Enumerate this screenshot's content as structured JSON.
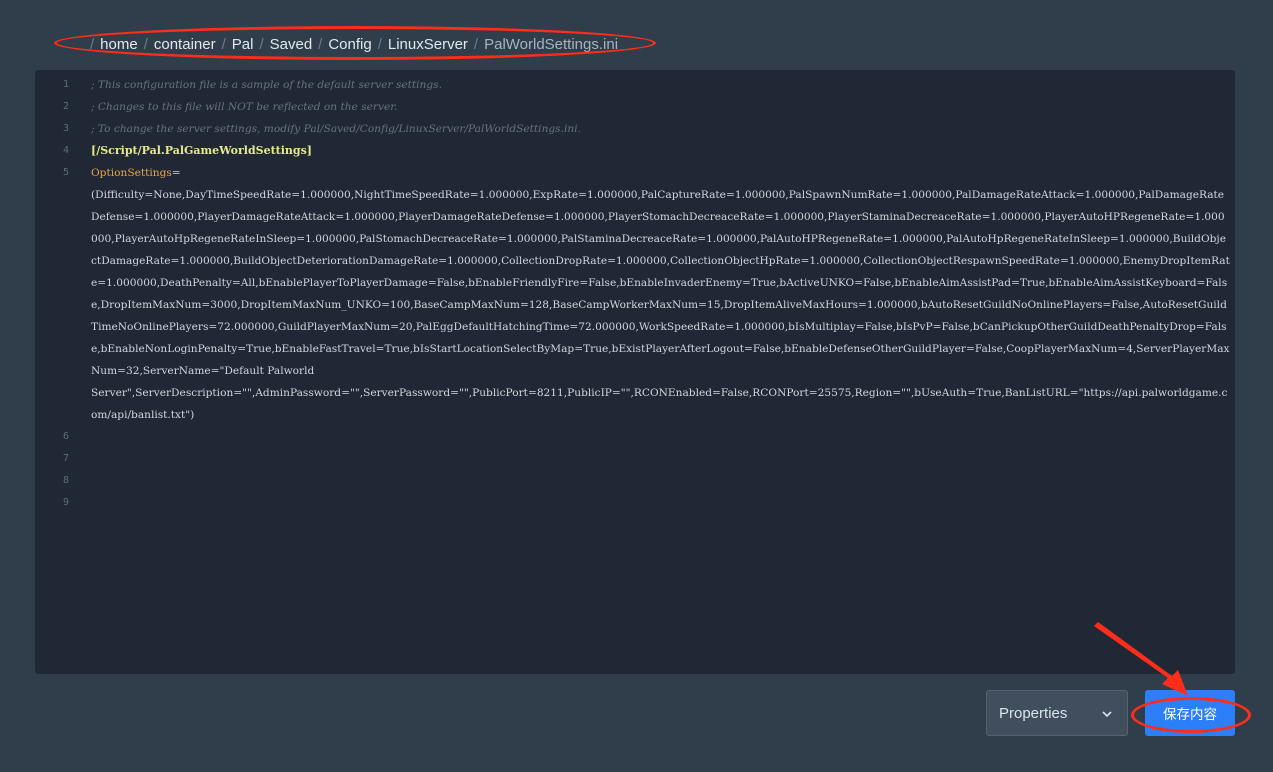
{
  "breadcrumb": {
    "separator": "/",
    "items": [
      "home",
      "container",
      "Pal",
      "Saved",
      "Config",
      "LinuxServer"
    ],
    "current": "PalWorldSettings.ini"
  },
  "editor": {
    "line_numbers": [
      "1",
      "2",
      "3",
      "4",
      "5",
      "6",
      "7",
      "8",
      "9"
    ],
    "lines": {
      "l1": "; This configuration file is a sample of the default server settings.",
      "l2": "; Changes to this file will NOT be reflected on the server.",
      "l3": "; To change the server settings, modify Pal/Saved/Config/LinuxServer/PalWorldSettings.ini.",
      "l4": "[/Script/Pal.PalGameWorldSettings]",
      "l5_key": "OptionSettings",
      "l5_eq": "=",
      "l5_value": "(Difficulty=None,DayTimeSpeedRate=1.000000,NightTimeSpeedRate=1.000000,ExpRate=1.000000,PalCaptureRate=1.000000,PalSpawnNumRate=1.000000,PalDamageRateAttack=1.000000,PalDamageRateDefense=1.000000,PlayerDamageRateAttack=1.000000,PlayerDamageRateDefense=1.000000,PlayerStomachDecreaceRate=1.000000,PlayerStaminaDecreaceRate=1.000000,PlayerAutoHPRegeneRate=1.000000,PlayerAutoHpRegeneRateInSleep=1.000000,PalStomachDecreaceRate=1.000000,PalStaminaDecreaceRate=1.000000,PalAutoHPRegeneRate=1.000000,PalAutoHpRegeneRateInSleep=1.000000,BuildObjectDamageRate=1.000000,BuildObjectDeteriorationDamageRate=1.000000,CollectionDropRate=1.000000,CollectionObjectHpRate=1.000000,CollectionObjectRespawnSpeedRate=1.000000,EnemyDropItemRate=1.000000,DeathPenalty=All,bEnablePlayerToPlayerDamage=False,bEnableFriendlyFire=False,bEnableInvaderEnemy=True,bActiveUNKO=False,bEnableAimAssistPad=True,bEnableAimAssistKeyboard=False,DropItemMaxNum=3000,DropItemMaxNum_UNKO=100,BaseCampMaxNum=128,BaseCampWorkerMaxNum=15,DropItemAliveMaxHours=1.000000,bAutoResetGuildNoOnlinePlayers=False,AutoResetGuildTimeNoOnlinePlayers=72.000000,GuildPlayerMaxNum=20,PalEggDefaultHatchingTime=72.000000,WorkSpeedRate=1.000000,bIsMultiplay=False,bIsPvP=False,bCanPickupOtherGuildDeathPenaltyDrop=False,bEnableNonLoginPenalty=True,bEnableFastTravel=True,bIsStartLocationSelectByMap=True,bExistPlayerAfterLogout=False,bEnableDefenseOtherGuildPlayer=False,CoopPlayerMaxNum=4,ServerPlayerMaxNum=32,ServerName=\"Default Palworld\nServer\",ServerDescription=\"\",AdminPassword=\"\",ServerPassword=\"\",PublicPort=8211,PublicIP=\"\",RCONEnabled=False,RCONPort=25575,Region=\"\",bUseAuth=True,BanListURL=\"https://api.palworldgame.com/api/banlist.txt\")"
    }
  },
  "footer": {
    "language_select": {
      "value": "Properties"
    },
    "save_label": "保存内容"
  },
  "colors": {
    "background": "#303d4a",
    "editor_background": "#212835",
    "accent": "#2d7ff9",
    "annotation": "#ff2d1a",
    "section_header": "#e6e98a",
    "key": "#e8a64a",
    "comment": "#68727e"
  }
}
